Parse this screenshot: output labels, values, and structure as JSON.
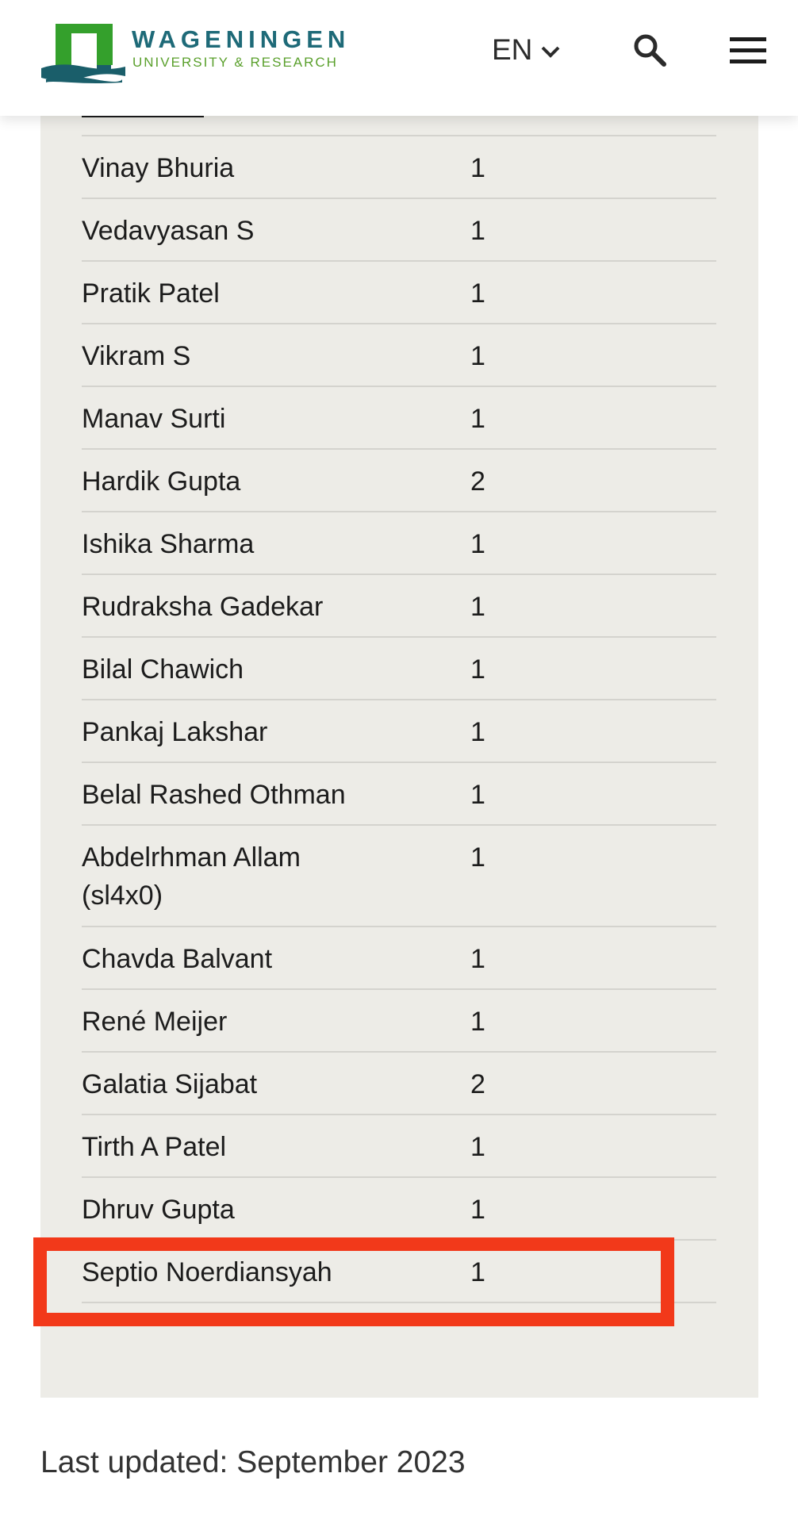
{
  "header": {
    "logo_title": "WAGENINGEN",
    "logo_subtitle": "UNIVERSITY & RESEARCH",
    "language": "EN"
  },
  "contributors": [
    {
      "name": "Vinay Bhuria",
      "count": "1"
    },
    {
      "name": "Vedavyasan S",
      "count": "1"
    },
    {
      "name": "Pratik Patel",
      "count": "1"
    },
    {
      "name": "Vikram S",
      "count": "1"
    },
    {
      "name": "Manav Surti",
      "count": "1"
    },
    {
      "name": "Hardik Gupta",
      "count": "2"
    },
    {
      "name": "Ishika Sharma",
      "count": "1"
    },
    {
      "name": "Rudraksha Gadekar",
      "count": "1"
    },
    {
      "name": "Bilal Chawich",
      "count": "1"
    },
    {
      "name": "Pankaj Lakshar",
      "count": "1"
    },
    {
      "name": "Belal Rashed Othman",
      "count": "1"
    },
    {
      "name": "Abdelrhman Allam (sl4x0)",
      "count": "1"
    },
    {
      "name": "Chavda Balvant",
      "count": "1"
    },
    {
      "name": "René Meijer",
      "count": "1"
    },
    {
      "name": "Galatia Sijabat",
      "count": "2"
    },
    {
      "name": "Tirth A Patel",
      "count": "1"
    },
    {
      "name": "Dhruv Gupta",
      "count": "1"
    },
    {
      "name": "Septio Noerdiansyah",
      "count": "1"
    }
  ],
  "footer": {
    "last_updated": "Last updated: September 2023"
  },
  "colors": {
    "brand_teal": "#1e6a78",
    "brand_green": "#5aa02c",
    "logo_green": "#34a02c",
    "panel_bg": "#edece7",
    "highlight": "#f2391a"
  }
}
